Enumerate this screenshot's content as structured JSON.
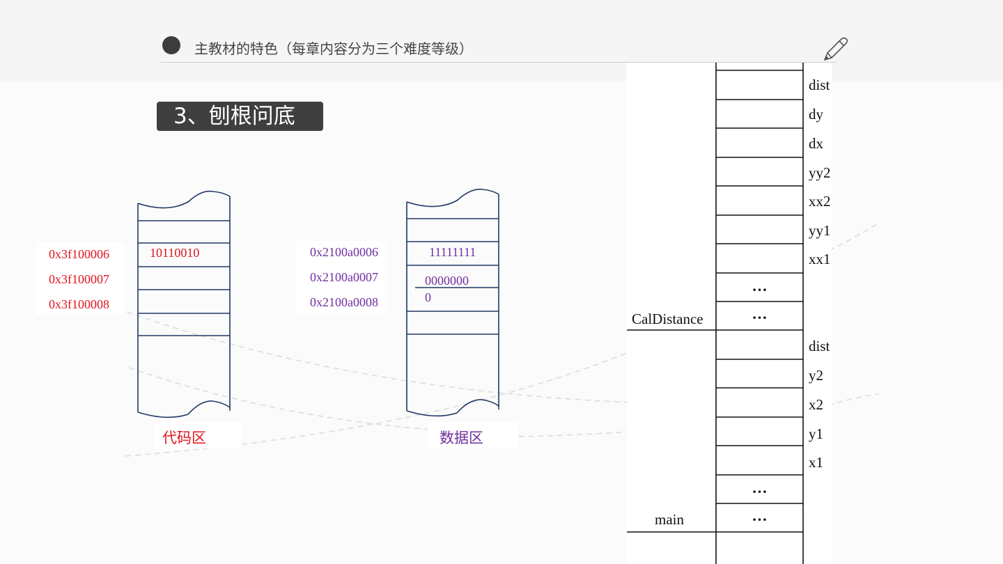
{
  "header": {
    "title": "主教材的特色（每章内容分为三个难度等级）",
    "icon": "pen-icon"
  },
  "section": {
    "title": "3、刨根问底"
  },
  "colors": {
    "code": "#e0141e",
    "data": "#7030a0",
    "column": "#1f3864"
  },
  "code_area": {
    "caption": "代码区",
    "addresses": [
      "0x3f100006",
      "0x3f100007",
      "0x3f100008"
    ],
    "first_value": "10110010"
  },
  "data_area": {
    "caption": "数据区",
    "addresses": [
      "0x2100a0006",
      "0x2100a0007",
      "0x2100a0008"
    ],
    "values": [
      "11111111",
      "0000000",
      "0"
    ]
  },
  "stack": {
    "frame_labels": [
      "CalDistance",
      "main"
    ],
    "cell_labels": [
      "dist",
      "dy",
      "dx",
      "yy2",
      "xx2",
      "yy1",
      "xx1",
      "",
      "",
      "dist",
      "y2",
      "x2",
      "y1",
      "x1",
      "",
      ""
    ],
    "ellipsis": "…"
  }
}
